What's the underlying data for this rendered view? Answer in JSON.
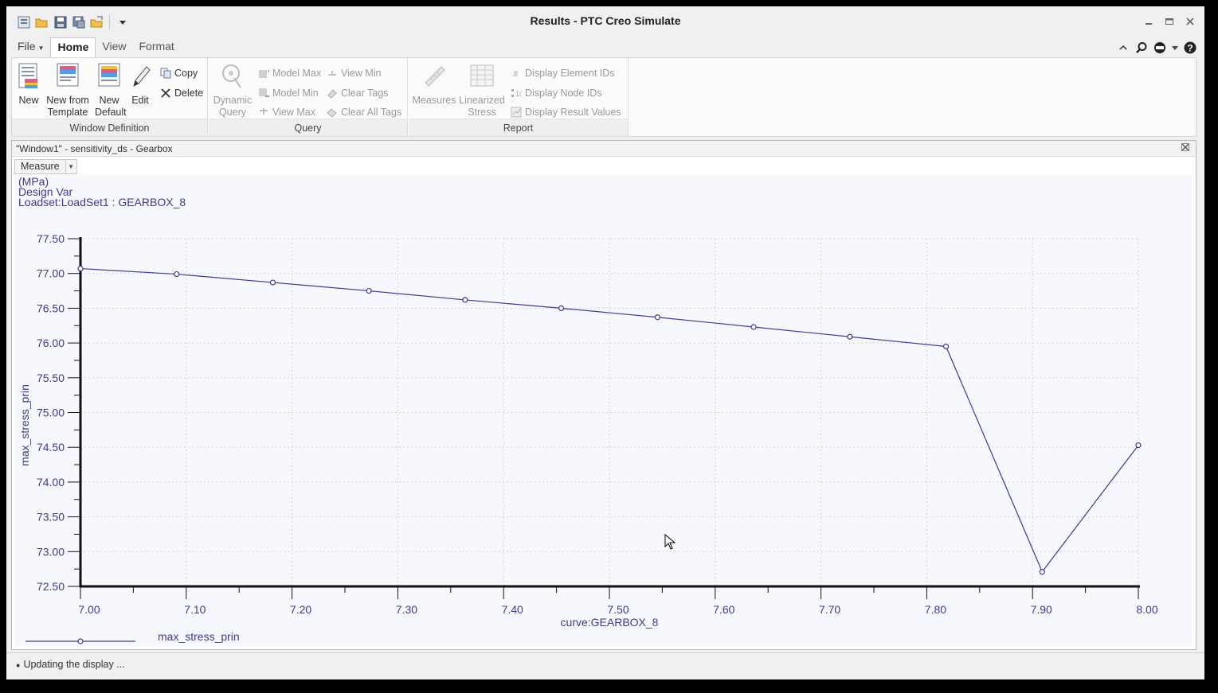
{
  "window": {
    "title": "Results - PTC Creo Simulate"
  },
  "quick_access": [
    "new-icon",
    "open-icon",
    "save-icon",
    "save-as-icon",
    "close-window-icon",
    "customize-icon"
  ],
  "menu": {
    "tabs": [
      {
        "label": "File"
      },
      {
        "label": "Home"
      },
      {
        "label": "View"
      },
      {
        "label": "Format"
      }
    ],
    "active": "Home"
  },
  "ribbon": {
    "window_definition": {
      "label": "Window Definition",
      "new": "New",
      "new_from_template_1": "New from",
      "new_from_template_2": "Template",
      "new_default_1": "New",
      "new_default_2": "Default",
      "edit": "Edit",
      "copy": "Copy",
      "delete": "Delete"
    },
    "query": {
      "label": "Query",
      "dynamic_query_1": "Dynamic",
      "dynamic_query_2": "Query",
      "model_max": "Model Max",
      "model_min": "Model Min",
      "view_max": "View Max",
      "view_min": "View Min",
      "clear_tags": "Clear Tags",
      "clear_all_tags": "Clear All Tags"
    },
    "report": {
      "label": "Report",
      "measures": "Measures",
      "linearized_stress_1": "Linearized",
      "linearized_stress_2": "Stress",
      "display_element_ids": "Display Element IDs",
      "display_node_ids": "Display Node IDs",
      "display_result_values": "Display Result Values"
    }
  },
  "plot_window": {
    "title": "\"Window1\" - sensitivity_ds - Gearbox",
    "measure_label": "Measure"
  },
  "chart_data": {
    "type": "line",
    "header_lines": [
      "(MPa)",
      "Design Var",
      "Loadset:LoadSet1 :  GEARBOX_8"
    ],
    "xlabel": "curve:GEARBOX_8",
    "ylabel": "max_stress_prin",
    "xlim": [
      7.0,
      8.0
    ],
    "ylim": [
      72.5,
      77.5
    ],
    "x_ticks": [
      "7.00",
      "7.10",
      "7.20",
      "7.30",
      "7.40",
      "7.50",
      "7.60",
      "7.70",
      "7.80",
      "7.90",
      "8.00"
    ],
    "y_ticks": [
      "77.50",
      "77.00",
      "76.50",
      "76.00",
      "75.50",
      "75.00",
      "74.50",
      "74.00",
      "73.50",
      "73.00",
      "72.50"
    ],
    "grid": true,
    "legend": "bottom-left",
    "series": [
      {
        "name": "max_stress_prin",
        "color": "#3a3a9c",
        "x": [
          7.0,
          7.0909,
          7.1818,
          7.2727,
          7.3636,
          7.4545,
          7.5455,
          7.6364,
          7.7273,
          7.8182,
          7.9091,
          8.0
        ],
        "y": [
          77.07,
          76.99,
          76.87,
          76.75,
          76.62,
          76.5,
          76.37,
          76.23,
          76.09,
          75.95,
          72.71,
          74.53
        ]
      }
    ]
  },
  "status": {
    "text": "Updating the display ..."
  }
}
